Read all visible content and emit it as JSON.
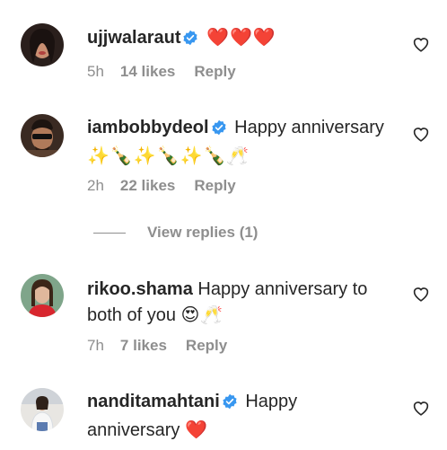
{
  "comments": [
    {
      "username": "ujjwalaraut",
      "verified": true,
      "text": "",
      "emojis": "❤️❤️❤️",
      "time": "5h",
      "likes": "14 likes",
      "reply": "Reply"
    },
    {
      "username": "iambobbydeol",
      "verified": true,
      "text": "Happy anniversary",
      "emojis": "✨🍾✨🍾✨🍾🥂",
      "time": "2h",
      "likes": "22 likes",
      "reply": "Reply",
      "view_replies": "View replies (1)"
    },
    {
      "username": "rikoo.shama",
      "verified": false,
      "text_line1": "Happy anniversary to",
      "text_line2": "both of you",
      "emojis": "😍🥂",
      "time": "7h",
      "likes": "7 likes",
      "reply": "Reply"
    },
    {
      "username": "nanditamahtani",
      "verified": true,
      "text_line1": "Happy",
      "text_line2": "anniversary",
      "emojis": "❤️"
    }
  ],
  "colors": {
    "text": "#262626",
    "secondary": "#8e8e8e",
    "verified": "#3897f0",
    "heart": "#ed4956"
  },
  "icons": {
    "like": "heart-outline-icon",
    "verified": "verified-badge-icon"
  }
}
